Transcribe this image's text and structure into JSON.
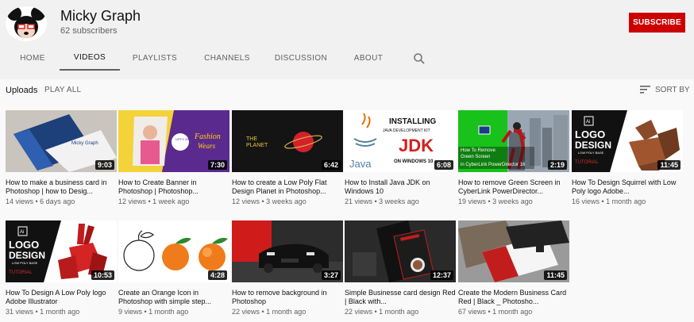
{
  "channel": {
    "title": "Micky Graph",
    "subscribers": "62 subscribers",
    "subscribe_label": "SUBSCRIBE"
  },
  "tabs": [
    "HOME",
    "VIDEOS",
    "PLAYLISTS",
    "CHANNELS",
    "DISCUSSION",
    "ABOUT"
  ],
  "active_tab": "VIDEOS",
  "toolbar": {
    "uploads": "Uploads",
    "play_all": "PLAY ALL",
    "sort_by": "SORT BY"
  },
  "colors": {
    "brand_red": "#cc0000"
  },
  "videos": [
    {
      "title": "How to make a business card in Photoshop | how to Desig...",
      "views": "14 views",
      "age": "6 days ago",
      "duration": "9:03"
    },
    {
      "title": "How to Create Banner in Photoshop | Photoshop...",
      "views": "12 views",
      "age": "1 week ago",
      "duration": "7:30",
      "thumb_text": {
        "line1": "Fashion",
        "line2": "Wears",
        "badge": "UPTO 25% OFF"
      }
    },
    {
      "title": "How to create a Low Poly Flat Design Planet in Photoshop...",
      "views": "12 views",
      "age": "3 weeks ago",
      "duration": "6:42",
      "thumb_text": {
        "line1": "THE",
        "line2": "PLANET"
      }
    },
    {
      "title": "How to Install Java JDK on Windows 10",
      "views": "21 views",
      "age": "3 weeks ago",
      "duration": "6:08",
      "thumb_text": {
        "line1": "INSTALLING",
        "line2": "JAVA DEVELOPMENT KIT",
        "line3": "JDK",
        "line4": "ON WINDOWS 10",
        "logo": "Java"
      }
    },
    {
      "title": "How to remove Green Screen in CyberLink PowerDirector...",
      "views": "19 views",
      "age": "3 weeks ago",
      "duration": "2:19",
      "thumb_text": {
        "line1": "How To Remove",
        "line2": "Green Screen",
        "line3": "in CyberLink PowerDirector 16"
      }
    },
    {
      "title": "How To Design Squirrel with Low Poly logo Adobe...",
      "views": "16 views",
      "age": "1 month ago",
      "duration": "11:45",
      "thumb_text": {
        "ai": "Ai",
        "line1": "LOGO",
        "line2": "DESIGN",
        "line3": "LOW POLY BASE",
        "line4": "TUTORIAL"
      }
    },
    {
      "title": "How To Design A Low Poly logo Adobe Illustrator",
      "views": "31 views",
      "age": "1 month ago",
      "duration": "10:53",
      "thumb_text": {
        "ai": "Ai",
        "line1": "LOGO",
        "line2": "DESIGN",
        "line3": "LOW POLY BASE",
        "line4": "TUTORIAL"
      }
    },
    {
      "title": "Create an Orange Icon in Photoshop with simple step...",
      "views": "9 views",
      "age": "1 month ago",
      "duration": "4:28"
    },
    {
      "title": "How to remove background in Photoshop",
      "views": "22 views",
      "age": "1 month ago",
      "duration": "3:27"
    },
    {
      "title": "Simple Businesse card design Red | Black with...",
      "views": "22 views",
      "age": "1 month ago",
      "duration": "12:37"
    },
    {
      "title": "Create the Modern Business Card Red | Black _ Photosho...",
      "views": "67 views",
      "age": "1 month ago",
      "duration": "11:45"
    }
  ]
}
